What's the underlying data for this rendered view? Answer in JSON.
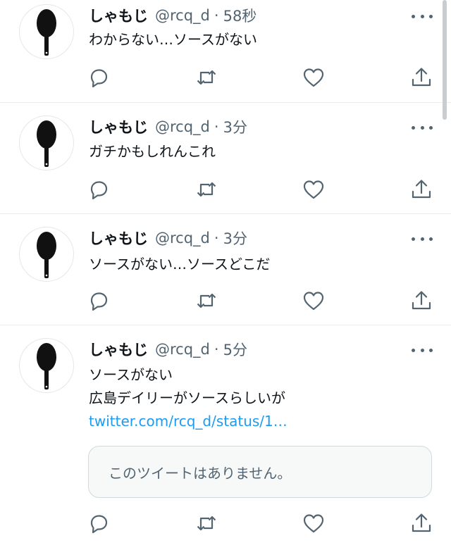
{
  "tweets": [
    {
      "name": "しゃもじ",
      "handle": "@rcq_d",
      "separator": "·",
      "time": "58秒",
      "lines": [
        "わからない…ソースがない"
      ]
    },
    {
      "name": "しゃもじ",
      "handle": "@rcq_d",
      "separator": "·",
      "time": "3分",
      "lines": [
        "ガチかもしれんこれ"
      ]
    },
    {
      "name": "しゃもじ",
      "handle": "@rcq_d",
      "separator": "·",
      "time": "3分",
      "lines": [
        "ソースがない…ソースどこだ"
      ]
    },
    {
      "name": "しゃもじ",
      "handle": "@rcq_d",
      "separator": "·",
      "time": "5分",
      "lines": [
        "ソースがない",
        "広島デイリーがソースらしいが"
      ],
      "link": "twitter.com/rcq_d/status/1…",
      "quote_text": "このツイートはありません。"
    }
  ],
  "icons": {
    "reply": "reply-icon",
    "retweet": "retweet-icon",
    "like": "like-icon",
    "share": "share-icon",
    "more": "more-icon",
    "avatar": "rice-paddle-avatar"
  },
  "colors": {
    "text": "#0f1419",
    "secondary": "#536471",
    "link": "#1d9bf0",
    "divider": "#e6ecf0"
  }
}
